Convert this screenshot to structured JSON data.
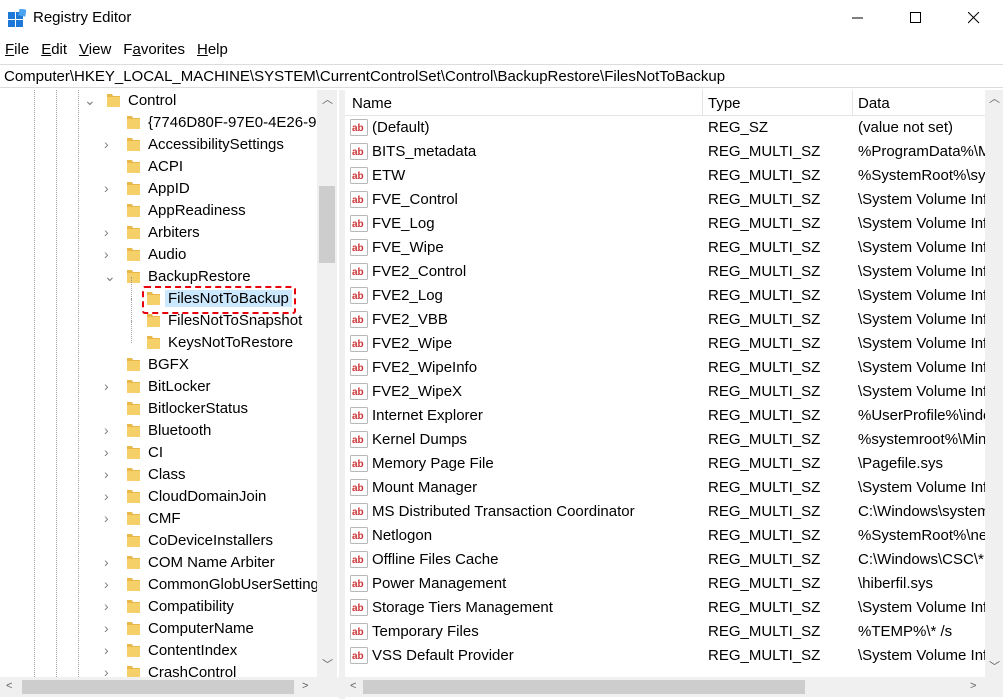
{
  "window": {
    "title": "Registry Editor",
    "icons": {
      "app": "registry-editor-icon",
      "minimize": "minimize-icon",
      "maximize": "maximize-icon",
      "close": "close-icon"
    }
  },
  "menu": [
    {
      "label": "File",
      "accel": "F",
      "rest": "ile"
    },
    {
      "label": "Edit",
      "accel": "E",
      "rest": "dit"
    },
    {
      "label": "View",
      "accel": "V",
      "rest": "iew"
    },
    {
      "label": "Favorites",
      "accel": "a",
      "pre": "F",
      "rest": "vorites"
    },
    {
      "label": "Help",
      "accel": "H",
      "rest": "elp"
    }
  ],
  "address": "Computer\\HKEY_LOCAL_MACHINE\\SYSTEM\\CurrentControlSet\\Control\\BackupRestore\\FilesNotToBackup",
  "tree": {
    "parent": "Control",
    "items": [
      {
        "label": "{7746D80F-97E0-4E26-95",
        "expandable": false
      },
      {
        "label": "AccessibilitySettings",
        "expandable": true
      },
      {
        "label": "ACPI",
        "expandable": false
      },
      {
        "label": "AppID",
        "expandable": true
      },
      {
        "label": "AppReadiness",
        "expandable": false
      },
      {
        "label": "Arbiters",
        "expandable": true
      },
      {
        "label": "Audio",
        "expandable": true
      },
      {
        "label": "BackupRestore",
        "expandable": true,
        "expanded": true
      },
      {
        "label": "FilesNotToBackup",
        "child": true,
        "selected": true
      },
      {
        "label": "FilesNotToSnapshot",
        "child": true
      },
      {
        "label": "KeysNotToRestore",
        "child": true
      },
      {
        "label": "BGFX",
        "expandable": false
      },
      {
        "label": "BitLocker",
        "expandable": true
      },
      {
        "label": "BitlockerStatus",
        "expandable": false
      },
      {
        "label": "Bluetooth",
        "expandable": true
      },
      {
        "label": "CI",
        "expandable": true
      },
      {
        "label": "Class",
        "expandable": true
      },
      {
        "label": "CloudDomainJoin",
        "expandable": true
      },
      {
        "label": "CMF",
        "expandable": true
      },
      {
        "label": "CoDeviceInstallers",
        "expandable": false
      },
      {
        "label": "COM Name Arbiter",
        "expandable": true
      },
      {
        "label": "CommonGlobUserSetting",
        "expandable": true
      },
      {
        "label": "Compatibility",
        "expandable": true
      },
      {
        "label": "ComputerName",
        "expandable": true
      },
      {
        "label": "ContentIndex",
        "expandable": true
      },
      {
        "label": "CrashControl",
        "expandable": true
      }
    ]
  },
  "list": {
    "headers": {
      "name": "Name",
      "type": "Type",
      "data": "Data"
    },
    "rows": [
      {
        "name": "(Default)",
        "type": "REG_SZ",
        "data": "(value not set)"
      },
      {
        "name": "BITS_metadata",
        "type": "REG_MULTI_SZ",
        "data": "%ProgramData%\\M"
      },
      {
        "name": "ETW",
        "type": "REG_MULTI_SZ",
        "data": "%SystemRoot%\\sys"
      },
      {
        "name": "FVE_Control",
        "type": "REG_MULTI_SZ",
        "data": "\\System Volume Inf"
      },
      {
        "name": "FVE_Log",
        "type": "REG_MULTI_SZ",
        "data": "\\System Volume Inf"
      },
      {
        "name": "FVE_Wipe",
        "type": "REG_MULTI_SZ",
        "data": "\\System Volume Inf"
      },
      {
        "name": "FVE2_Control",
        "type": "REG_MULTI_SZ",
        "data": "\\System Volume Inf"
      },
      {
        "name": "FVE2_Log",
        "type": "REG_MULTI_SZ",
        "data": "\\System Volume Inf"
      },
      {
        "name": "FVE2_VBB",
        "type": "REG_MULTI_SZ",
        "data": "\\System Volume Inf"
      },
      {
        "name": "FVE2_Wipe",
        "type": "REG_MULTI_SZ",
        "data": "\\System Volume Inf"
      },
      {
        "name": "FVE2_WipeInfo",
        "type": "REG_MULTI_SZ",
        "data": "\\System Volume Inf"
      },
      {
        "name": "FVE2_WipeX",
        "type": "REG_MULTI_SZ",
        "data": "\\System Volume Inf"
      },
      {
        "name": "Internet Explorer",
        "type": "REG_MULTI_SZ",
        "data": "%UserProfile%\\inde"
      },
      {
        "name": "Kernel Dumps",
        "type": "REG_MULTI_SZ",
        "data": "%systemroot%\\Min"
      },
      {
        "name": "Memory Page File",
        "type": "REG_MULTI_SZ",
        "data": "\\Pagefile.sys"
      },
      {
        "name": "Mount Manager",
        "type": "REG_MULTI_SZ",
        "data": "\\System Volume Inf"
      },
      {
        "name": "MS Distributed Transaction Coordinator",
        "type": "REG_MULTI_SZ",
        "data": "C:\\Windows\\system"
      },
      {
        "name": "Netlogon",
        "type": "REG_MULTI_SZ",
        "data": "%SystemRoot%\\ne"
      },
      {
        "name": "Offline Files Cache",
        "type": "REG_MULTI_SZ",
        "data": "C:\\Windows\\CSC\\* "
      },
      {
        "name": "Power Management",
        "type": "REG_MULTI_SZ",
        "data": "\\hiberfil.sys"
      },
      {
        "name": "Storage Tiers Management",
        "type": "REG_MULTI_SZ",
        "data": "\\System Volume Inf"
      },
      {
        "name": "Temporary Files",
        "type": "REG_MULTI_SZ",
        "data": "%TEMP%\\* /s"
      },
      {
        "name": "VSS Default Provider",
        "type": "REG_MULTI_SZ",
        "data": "\\System Volume Inf"
      }
    ]
  },
  "colors": {
    "selection": "#cce8ff",
    "highlight_box": "#e8000b",
    "folder": "#e8b84a"
  }
}
